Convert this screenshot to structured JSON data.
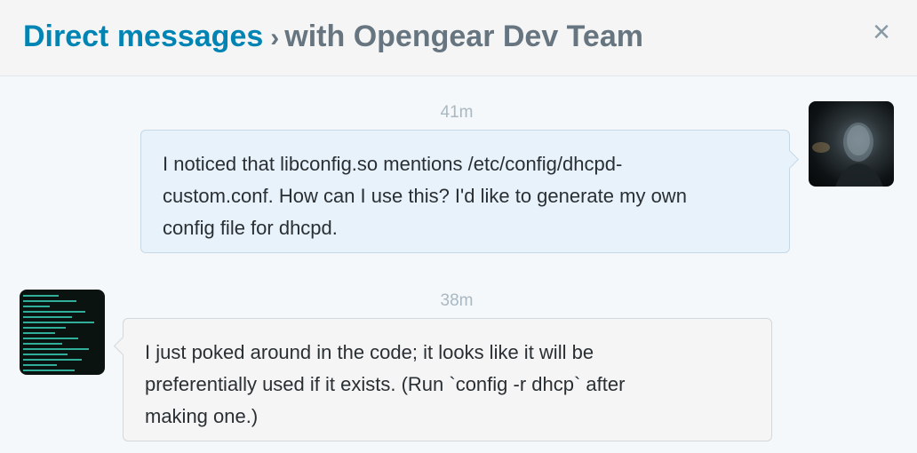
{
  "header": {
    "title_link": "Direct messages",
    "separator": "›",
    "title_rest": "with Opengear Dev Team",
    "close_glyph": "×"
  },
  "messages": [
    {
      "direction": "sent",
      "time": "41m",
      "lines": [
        "I noticed that libconfig.so mentions /etc/config/dhcpd-",
        "custom.conf. How can I use this? I'd like to generate my own",
        "config file for dhcpd."
      ]
    },
    {
      "direction": "received",
      "time": "38m",
      "lines": [
        "I just poked around in the code; it looks like it will be",
        "preferentially used if it exists.  (Run `config -r dhcp` after",
        "making one.)"
      ]
    }
  ],
  "icons": {
    "close": "close-icon",
    "sender_avatar": "user-avatar",
    "recipient_avatar": "terminal-avatar"
  },
  "colors": {
    "link": "#0084b4",
    "muted": "#66757f",
    "sent_bubble": "#e8f2fb",
    "received_bubble": "#f5f5f5"
  }
}
